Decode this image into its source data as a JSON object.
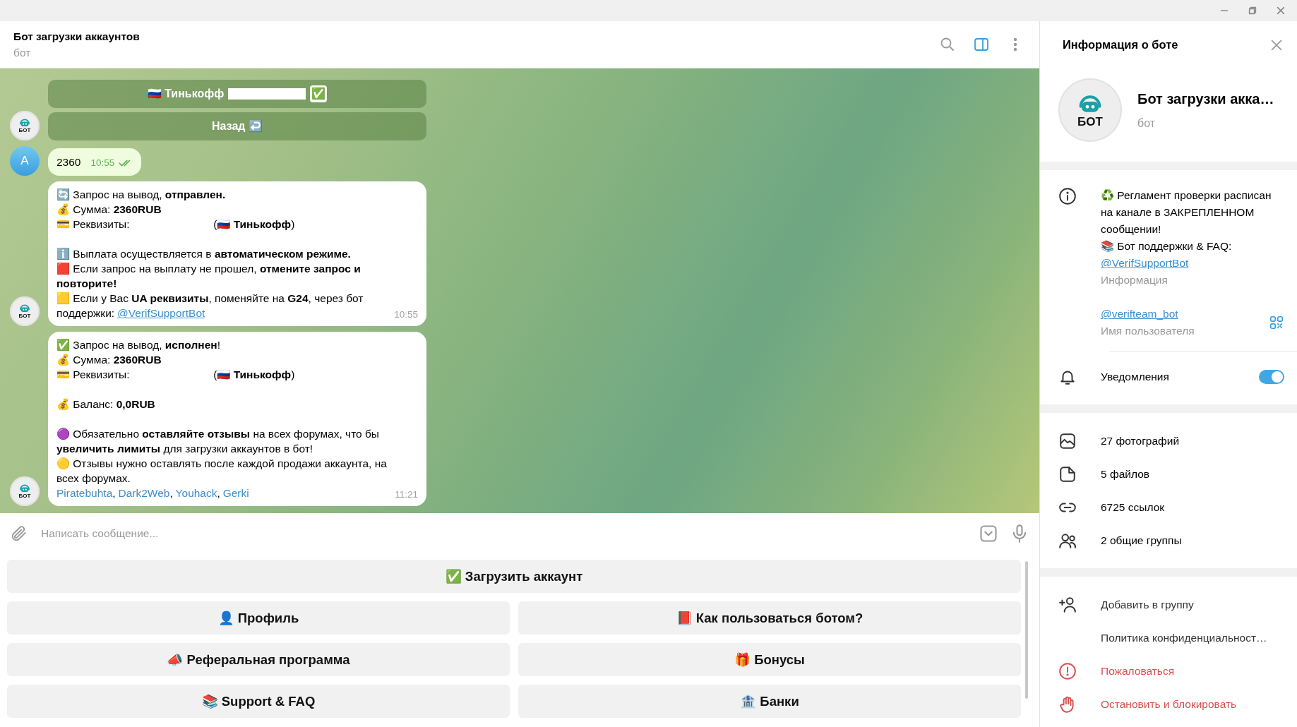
{
  "header": {
    "title": "Бот загрузки аккаунтов",
    "subtitle": "бот"
  },
  "chat": {
    "inline_buttons": [
      {
        "parts": [
          "🇷🇺 Тинькофф",
          "✅"
        ],
        "redacted": true
      },
      {
        "parts": [
          "Назад ↩️"
        ],
        "redacted": false
      }
    ],
    "inline_avatar": "БОТ",
    "messages": [
      {
        "kind": "outgoing",
        "avatar": "А",
        "text": "2360",
        "time": "10:55",
        "read": true
      },
      {
        "kind": "incoming",
        "avatar": "БОТ",
        "time": "10:55",
        "lines": [
          {
            "kind": "text",
            "text": "🔄 Запрос на вывод, **отправлен.**"
          },
          {
            "kind": "text",
            "text": "💰 Сумма: **2360RUB**"
          },
          {
            "kind": "redacted",
            "before": "💳 Реквизиты:",
            "after": "(🇷🇺 **Тинькофф**)"
          },
          {
            "kind": "gap"
          },
          {
            "kind": "text",
            "text": "ℹ️ Выплата осуществляется в **автоматическом режиме.**"
          },
          {
            "kind": "text",
            "text": "🟥 Если запрос на выплату не прошел, **отмените запрос и повторите!**"
          },
          {
            "kind": "text",
            "text": "🟨 Если у Вас **UA реквизиты**, поменяйте на **G24**, через бот поддержки:",
            "link": "@VerifSupportBot"
          }
        ]
      },
      {
        "kind": "incoming",
        "avatar": "БОТ",
        "time": "11:21",
        "lines": [
          {
            "kind": "text",
            "text": "✅ Запрос на вывод, **исполнен**!"
          },
          {
            "kind": "text",
            "text": "💰 Сумма: **2360RUB**"
          },
          {
            "kind": "redacted",
            "before": "💳 Реквизиты:",
            "after": "(🇷🇺 **Тинькофф**)"
          },
          {
            "kind": "gap"
          },
          {
            "kind": "text",
            "text": "💰 Баланс: **0,0RUB**"
          },
          {
            "kind": "gap"
          },
          {
            "kind": "text",
            "text": "🟣 Обязательно **оставляйте отзывы** на всех форумах, что бы **увеличить лимиты** для загрузки аккаунтов в бот!"
          },
          {
            "kind": "text",
            "text": "🟡 Отзывы нужно оставлять после каждой продажи аккаунта, на всех форумах."
          },
          {
            "kind": "links",
            "separator": ",",
            "links": [
              "Piratebuhta",
              "Dark2Web",
              "Youhack",
              "Gerki"
            ]
          }
        ]
      }
    ]
  },
  "composer": {
    "placeholder": "Написать сообщение..."
  },
  "keyboard": [
    [
      "✅ Загрузить аккаунт"
    ],
    [
      "👤 Профиль",
      "📕 Как пользоваться ботом?"
    ],
    [
      "📣 Реферальная программа",
      "🎁 Бонусы"
    ],
    [
      "📚 Support & FAQ",
      "🏦 Банки"
    ]
  ],
  "panel": {
    "title": "Информация о боте",
    "avatar": "БОТ",
    "name": "Бот загрузки акка…",
    "subtitle": "бот",
    "description": [
      "♻️ Регламент проверки расписан на канале в ЗАКРЕПЛЕННОМ сообщении!",
      "📚 Бот поддержки & FAQ:"
    ],
    "description_link": "@VerifSupportBot",
    "description_caption": "Информация",
    "username": "@verifteam_bot",
    "username_caption": "Имя пользователя",
    "notifications": {
      "label": "Уведомления",
      "on": true
    },
    "media": [
      {
        "kind": "photos",
        "text": "27 фотографий"
      },
      {
        "kind": "files",
        "text": "5 файлов"
      },
      {
        "kind": "links",
        "text": "6725 ссылок"
      },
      {
        "kind": "groups",
        "text": "2 общие группы"
      }
    ],
    "actions": [
      {
        "kind": "add",
        "text": "Добавить в группу",
        "danger": false
      },
      {
        "kind": "privacy",
        "text": "Политика конфиденциальност…",
        "danger": false
      },
      {
        "kind": "report",
        "text": "Пожаловаться",
        "danger": true
      },
      {
        "kind": "block",
        "text": "Остановить и блокировать",
        "danger": true
      }
    ]
  }
}
